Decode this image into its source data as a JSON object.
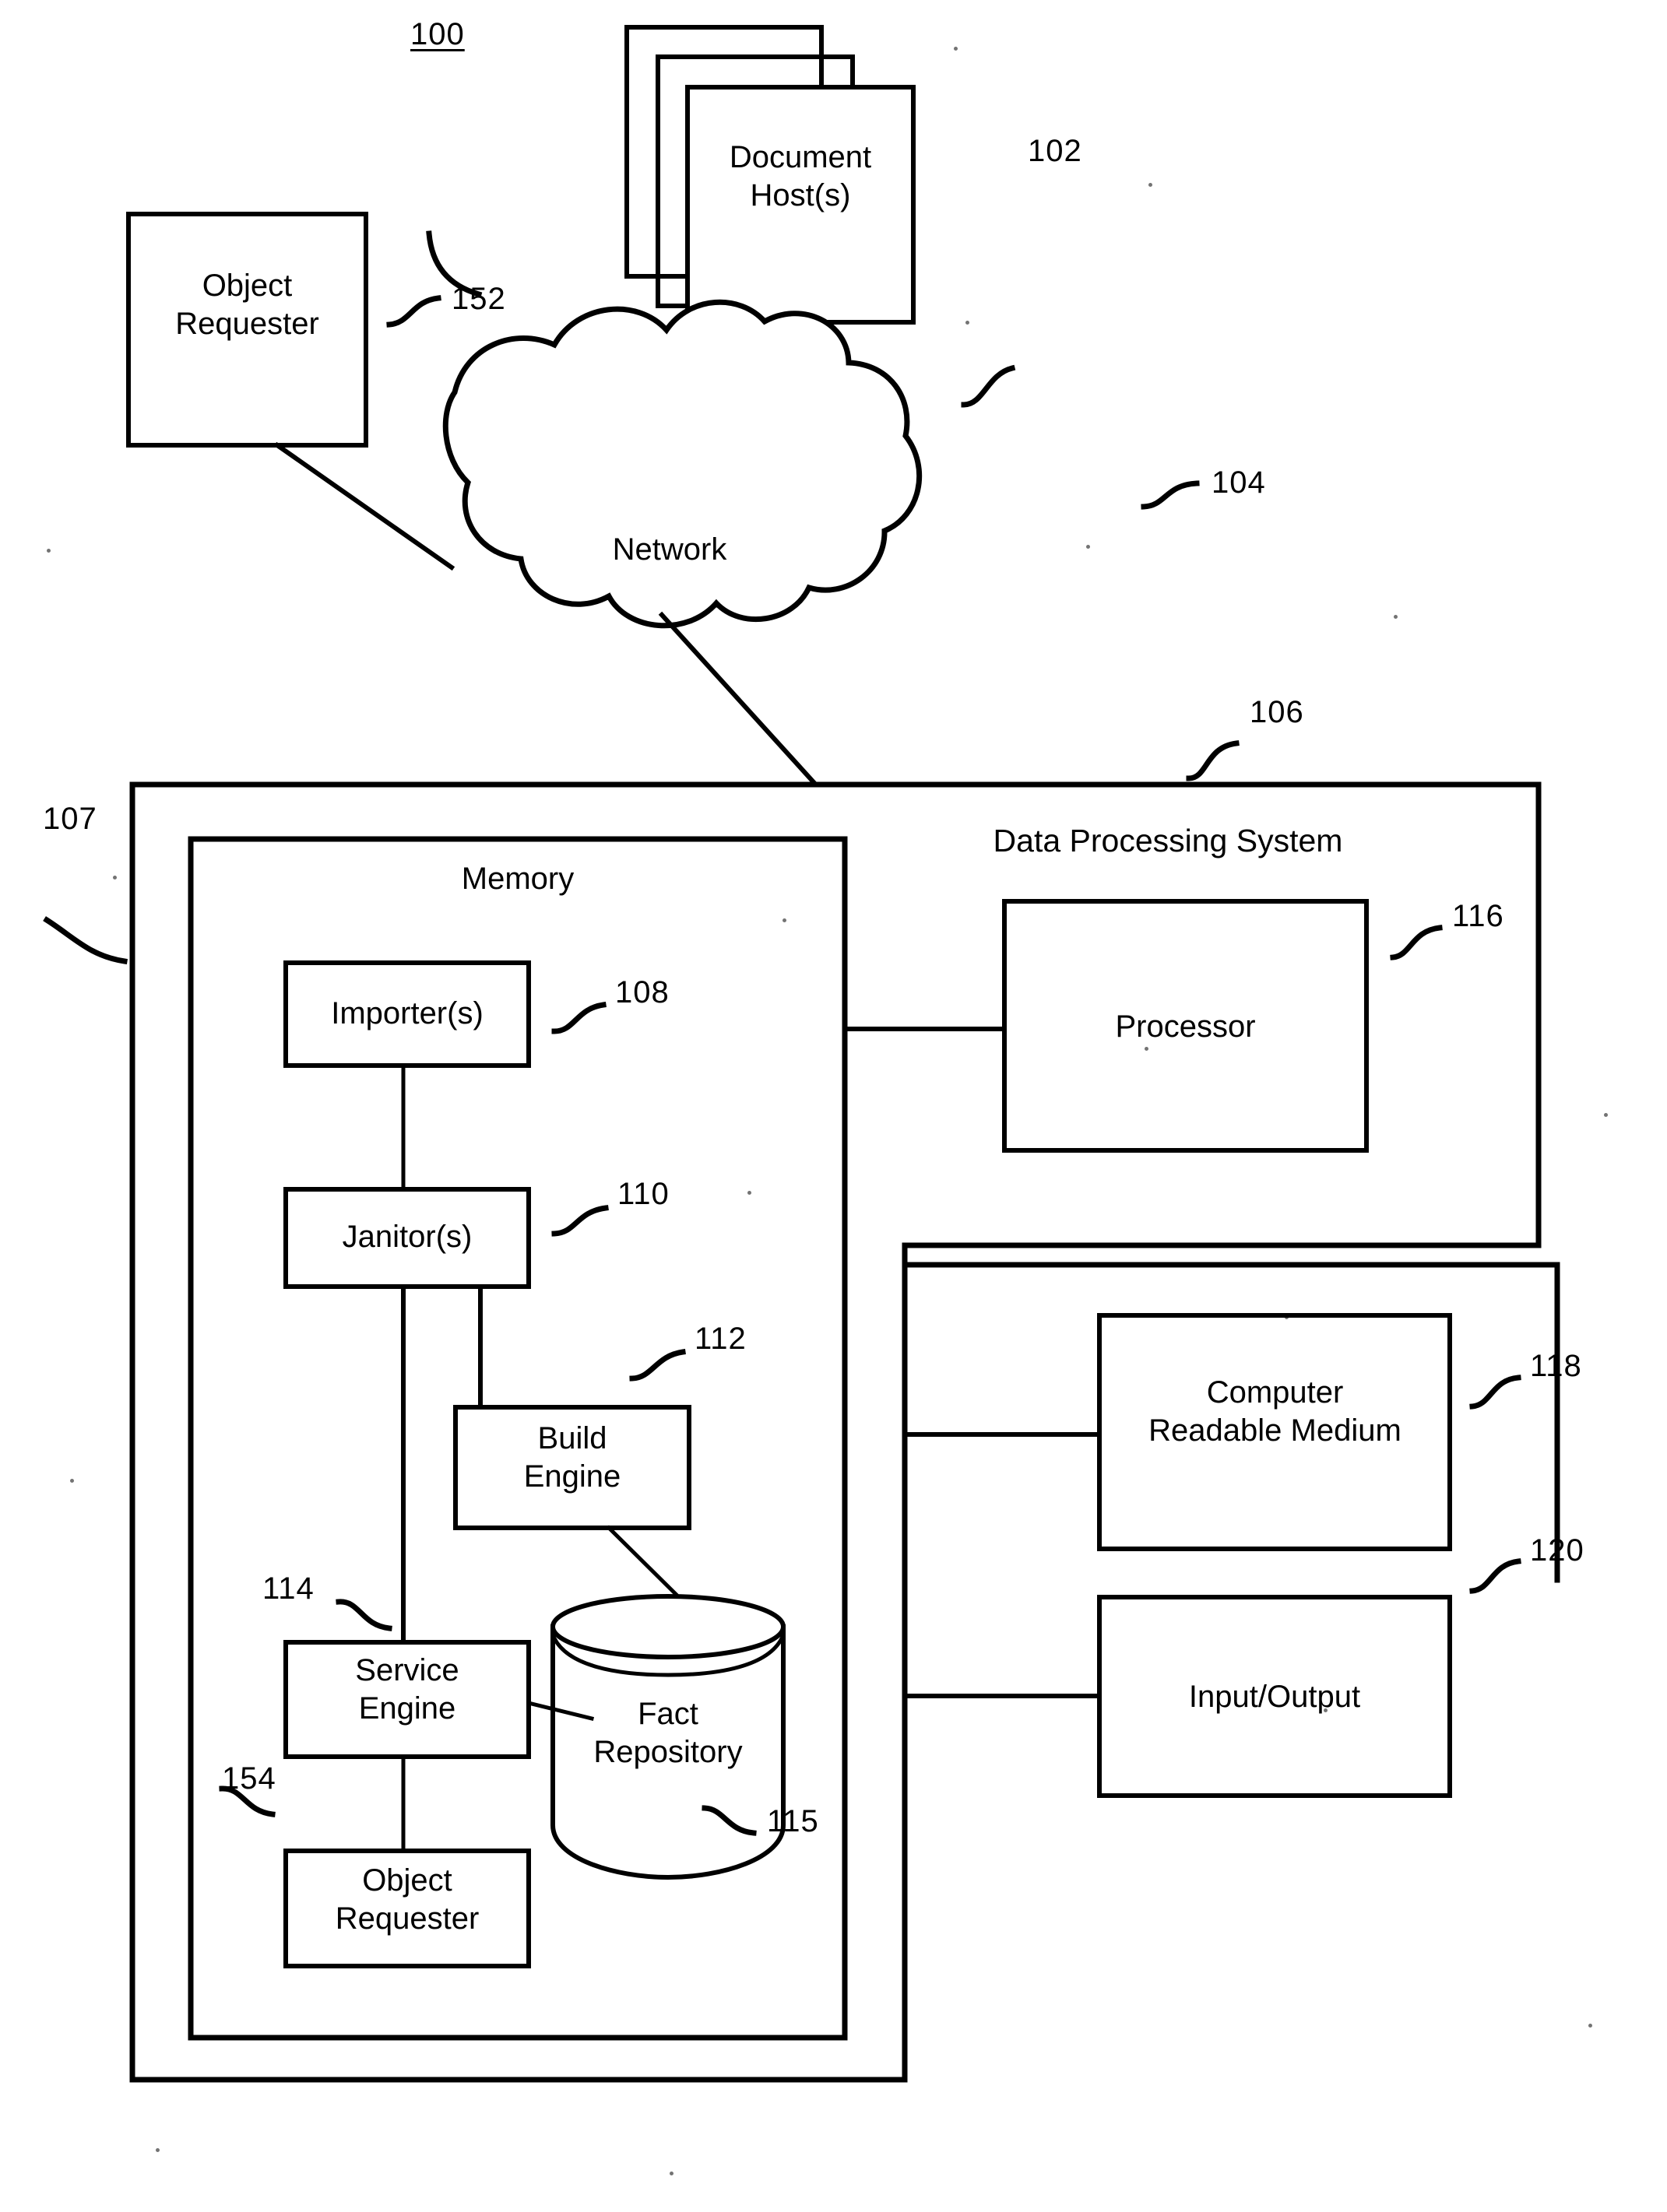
{
  "figure": {
    "figure_number": "100",
    "style": {
      "line_color": "#000000",
      "background": "#ffffff",
      "text_color": "#000000"
    }
  },
  "nodes": {
    "document_hosts": {
      "label": "Document\nHost(s)",
      "ref": "102",
      "shape": "stacked-rectangle"
    },
    "object_requester_external": {
      "label": "Object\nRequester",
      "ref": "152",
      "shape": "rectangle"
    },
    "network": {
      "label": "Network",
      "ref": "104",
      "shape": "cloud"
    },
    "data_processing_system": {
      "label": "Data Processing System",
      "ref": "106",
      "shape": "container"
    },
    "system_boundary": {
      "label": "",
      "ref": "107",
      "shape": "container"
    },
    "memory": {
      "label": "Memory",
      "shape": "container"
    },
    "importers": {
      "label": "Importer(s)",
      "ref": "108",
      "shape": "rectangle"
    },
    "janitors": {
      "label": "Janitor(s)",
      "ref": "110",
      "shape": "rectangle"
    },
    "build_engine": {
      "label": "Build\nEngine",
      "ref": "112",
      "shape": "rectangle"
    },
    "service_engine": {
      "label": "Service\nEngine",
      "ref": "114",
      "shape": "rectangle"
    },
    "fact_repository": {
      "label": "Fact\nRepository",
      "ref": "115",
      "shape": "cylinder"
    },
    "object_requester_internal": {
      "label": "Object\nRequester",
      "ref": "154",
      "shape": "rectangle"
    },
    "processor": {
      "label": "Processor",
      "ref": "116",
      "shape": "rectangle"
    },
    "computer_readable_medium": {
      "label": "Computer\nReadable Medium",
      "ref": "118",
      "shape": "rectangle"
    },
    "input_output": {
      "label": "Input/Output",
      "ref": "120",
      "shape": "rectangle"
    }
  },
  "reference_numerals": [
    {
      "id": "100",
      "text": "100",
      "underlined": true
    },
    {
      "id": "102",
      "text": "102",
      "underlined": false
    },
    {
      "id": "104",
      "text": "104",
      "underlined": false
    },
    {
      "id": "106",
      "text": "106",
      "underlined": false
    },
    {
      "id": "107",
      "text": "107",
      "underlined": false
    },
    {
      "id": "108",
      "text": "108",
      "underlined": false
    },
    {
      "id": "110",
      "text": "110",
      "underlined": false
    },
    {
      "id": "112",
      "text": "112",
      "underlined": false
    },
    {
      "id": "114",
      "text": "114",
      "underlined": false
    },
    {
      "id": "115",
      "text": "115",
      "underlined": false
    },
    {
      "id": "116",
      "text": "116",
      "underlined": false
    },
    {
      "id": "118",
      "text": "118",
      "underlined": false
    },
    {
      "id": "120",
      "text": "120",
      "underlined": false
    },
    {
      "id": "152",
      "text": "152",
      "underlined": false
    },
    {
      "id": "154",
      "text": "154",
      "underlined": false
    }
  ],
  "connections": [
    {
      "from": "document_hosts",
      "to": "network"
    },
    {
      "from": "object_requester_external",
      "to": "network"
    },
    {
      "from": "network",
      "to": "data_processing_system"
    },
    {
      "from": "importers",
      "to": "janitors"
    },
    {
      "from": "importers",
      "to": "processor"
    },
    {
      "from": "janitors",
      "to": "service_engine"
    },
    {
      "from": "janitors",
      "to": "build_engine"
    },
    {
      "from": "build_engine",
      "to": "fact_repository"
    },
    {
      "from": "service_engine",
      "to": "fact_repository"
    },
    {
      "from": "service_engine",
      "to": "object_requester_internal"
    },
    {
      "from": "system_boundary",
      "to": "computer_readable_medium"
    },
    {
      "from": "system_boundary",
      "to": "input_output"
    }
  ]
}
